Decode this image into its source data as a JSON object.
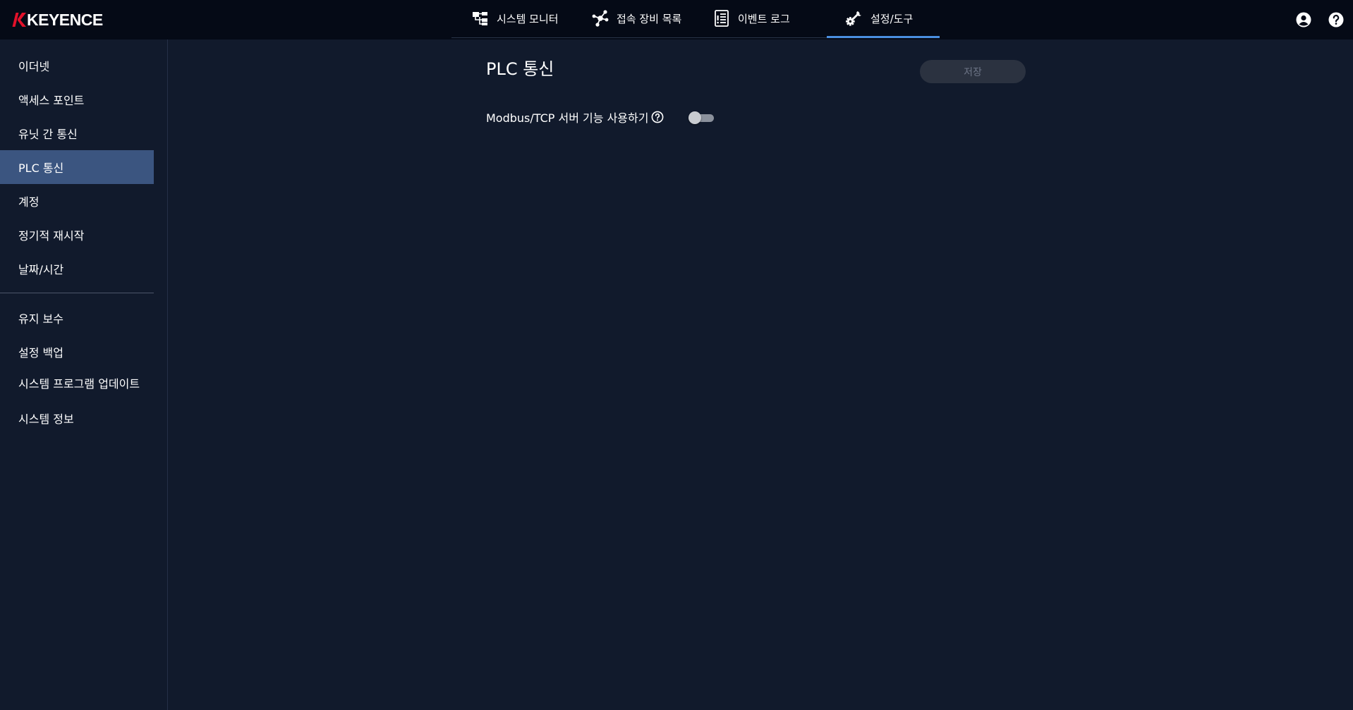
{
  "brand": {
    "logo_text": "KEYENCE",
    "accent": "#e3112a"
  },
  "nav": {
    "tabs": [
      {
        "label": "시스템 모니터",
        "icon": "system-monitor-icon"
      },
      {
        "label": "접속 장비 목록",
        "icon": "network-nodes-icon"
      },
      {
        "label": "이벤트 로그",
        "icon": "event-log-icon"
      },
      {
        "label": "설정/도구",
        "icon": "settings-tools-icon",
        "active": true
      }
    ],
    "active_color": "#4a8fe0"
  },
  "header_icons": [
    "account-icon",
    "help-icon"
  ],
  "sidebar": {
    "items": [
      {
        "label": "이더넷"
      },
      {
        "label": "액세스 포인트"
      },
      {
        "label": "유닛 간 통신"
      },
      {
        "label": "PLC 통신",
        "active": true
      },
      {
        "label": "계정"
      },
      {
        "label": "정기적 재시작"
      },
      {
        "label": "날짜/시간"
      }
    ],
    "items2": [
      {
        "label": "유지 보수"
      },
      {
        "label": "설정 백업"
      },
      {
        "label": "시스템 프로그램 업데이트"
      },
      {
        "label": "시스템 정보"
      }
    ],
    "active_color": "#3b5580"
  },
  "main": {
    "title": "PLC 통신",
    "save_label": "저장",
    "save_enabled": false,
    "modbus": {
      "label": "Modbus/TCP 서버 기능 사용하기",
      "enabled": false
    }
  }
}
